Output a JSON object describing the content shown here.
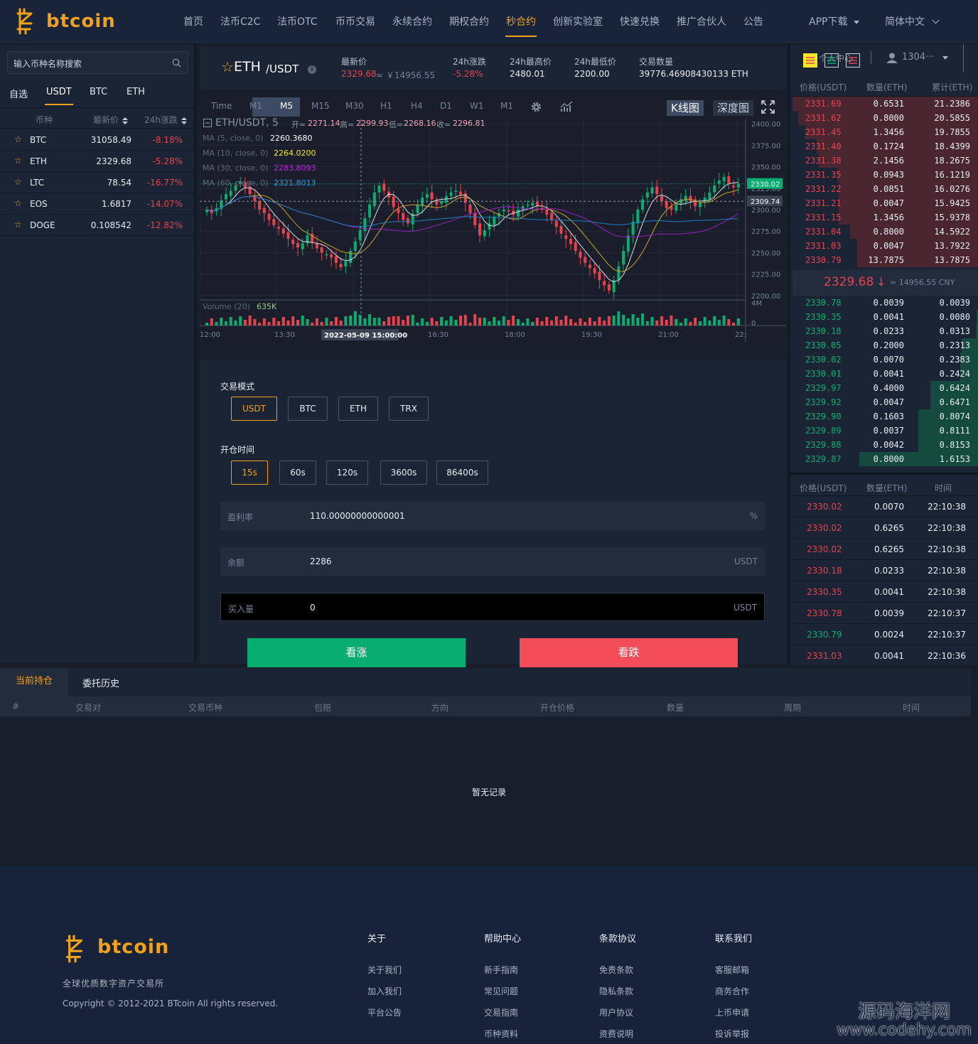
{
  "brand": {
    "name": "btcoin",
    "color": "#f0a21c",
    "tagline": "全球优质数字资产交易所",
    "copyright": "Copyright © 2012-2021 BTcoin All rights reserved."
  },
  "nav": {
    "items": [
      "首页",
      "法币C2C",
      "法币OTC",
      "币币交易",
      "永续合约",
      "期权合约",
      "秒合约",
      "创新实验室",
      "快速兑换",
      "推广合伙人",
      "公告"
    ],
    "active": "秒合约",
    "app_download": "APP下载",
    "language": "简体中文"
  },
  "market": {
    "search_placeholder": "输入币种名称搜索",
    "tabs": [
      "自选",
      "USDT",
      "BTC",
      "ETH"
    ],
    "active_tab": "USDT",
    "headers": {
      "coin": "币种",
      "price": "最新价",
      "change": "24h涨跌"
    },
    "rows": [
      {
        "symbol": "BTC",
        "price": "31058.49",
        "change": "-8.18%"
      },
      {
        "symbol": "ETH",
        "price": "2329.68",
        "change": "-5.28%"
      },
      {
        "symbol": "LTC",
        "price": "78.54",
        "change": "-16.77%"
      },
      {
        "symbol": "EOS",
        "price": "1.6817",
        "change": "-14.07%"
      },
      {
        "symbol": "DOGE",
        "price": "0.108542",
        "change": "-12.82%"
      }
    ]
  },
  "ticker": {
    "star": "☆",
    "base": "ETH",
    "quote": "/USDT",
    "last_label": "最新价",
    "last_price": "2329.68",
    "last_cny": "≈ ￥14956.55",
    "change_label": "24h涨跌",
    "change": "-5.28%",
    "high_label": "24h最高价",
    "high": "2480.01",
    "low_label": "24h最低价",
    "low": "2200.00",
    "volume_label": "交易数量",
    "volume": "39776.46908430133 ETH"
  },
  "chart": {
    "timeframes": [
      "Time",
      "M1",
      "M5",
      "M15",
      "M30",
      "H1",
      "H4",
      "D1",
      "W1",
      "M1"
    ],
    "active_timeframe": "M5",
    "view_kline": "K线图",
    "view_depth": "深度图",
    "legend_pair": "ETH/USDT, 5",
    "ohlc_labels": {
      "open": "开=",
      "high": "高=",
      "low": "低=",
      "close": "收="
    },
    "ohlc": {
      "open": "2271.14",
      "high": "2299.93",
      "low": "2268.16",
      "close": "2296.81"
    },
    "ma": [
      {
        "label": "MA (5, close, 0)",
        "value": "2260.3680",
        "color": "#ffffff"
      },
      {
        "label": "MA (10, close, 0)",
        "value": "2264.0200",
        "color": "#f3e52b"
      },
      {
        "label": "MA (30, close, 0)",
        "value": "2283.8093",
        "color": "#c41ee0"
      },
      {
        "label": "MA (60, close, 0)",
        "value": "2321.8013",
        "color": "#1e9be0"
      }
    ],
    "volume_label": "Volume (20)",
    "volume_value": "635K",
    "price_ticks": [
      "2400.00",
      "2375.00",
      "2350.00",
      "2325.00",
      "2300.00",
      "2275.00",
      "2250.00",
      "2225.00",
      "2200.00"
    ],
    "vol_ticks": [
      "4M",
      "0"
    ],
    "time_ticks": [
      "12:00",
      "13:30",
      "16:30",
      "18:00",
      "19:30",
      "21:00",
      "22:"
    ],
    "crosshair_time": "2022-05-09 15:00:00",
    "last_price_tag": "2330.02",
    "cross_price_tag": "2309.74"
  },
  "chart_data": {
    "type": "candlestick",
    "ylim": [
      2195,
      2405
    ],
    "close_series": [
      2300,
      2296,
      2302,
      2311,
      2318,
      2322,
      2328,
      2333,
      2326,
      2318,
      2310,
      2300,
      2296,
      2288,
      2282,
      2278,
      2272,
      2266,
      2260,
      2256,
      2261,
      2270,
      2262,
      2255,
      2250,
      2248,
      2244,
      2238,
      2233,
      2240,
      2252,
      2263,
      2276,
      2290,
      2306,
      2320,
      2328,
      2322,
      2314,
      2303,
      2296,
      2288,
      2284,
      2295,
      2306,
      2314,
      2318,
      2312,
      2306,
      2310,
      2316,
      2320,
      2322,
      2318,
      2308,
      2296,
      2282,
      2270,
      2276,
      2284,
      2292,
      2296,
      2300,
      2298,
      2294,
      2300,
      2304,
      2306,
      2308,
      2304,
      2300,
      2294,
      2288,
      2280,
      2272,
      2266,
      2260,
      2252,
      2244,
      2238,
      2232,
      2226,
      2218,
      2212,
      2206,
      2218,
      2234,
      2252,
      2270,
      2286,
      2300,
      2312,
      2320,
      2326,
      2318,
      2310,
      2302,
      2300,
      2306,
      2312,
      2316,
      2310,
      2304,
      2308,
      2314,
      2320,
      2328,
      2334,
      2338,
      2330,
      2326,
      2330
    ]
  },
  "form": {
    "mode_label": "交易模式",
    "modes": [
      "USDT",
      "BTC",
      "ETH",
      "TRX"
    ],
    "mode_selected": "USDT",
    "time_label": "开仓时间",
    "times": [
      "15s",
      "60s",
      "120s",
      "3600s",
      "86400s"
    ],
    "time_selected": "15s",
    "profit_label": "盈利率",
    "profit_value": "110.00000000000001",
    "profit_unit": "%",
    "balance_label": "余额",
    "balance_value": "2286",
    "balance_unit": "USDT",
    "amount_label": "买入量",
    "amount_value": "0",
    "amount_unit": "USDT",
    "buy_label": "看涨",
    "sell_label": "看跌"
  },
  "orderbook": {
    "user_label": "个人中心",
    "user_id": "1304···",
    "headers": {
      "price": "价格(USDT)",
      "amount": "数量(ETH)",
      "total": "累计(ETH)"
    },
    "asks": [
      {
        "p": "2331.69",
        "q": "0.6531",
        "c": "21.2386",
        "depth": 1.0
      },
      {
        "p": "2331.62",
        "q": "0.8000",
        "c": "20.5855",
        "depth": 0.97
      },
      {
        "p": "2331.45",
        "q": "1.3456",
        "c": "19.7855",
        "depth": 0.93
      },
      {
        "p": "2331.40",
        "q": "0.1724",
        "c": "18.4399",
        "depth": 0.87
      },
      {
        "p": "2331.38",
        "q": "2.1456",
        "c": "18.2675",
        "depth": 0.86
      },
      {
        "p": "2331.35",
        "q": "0.0943",
        "c": "16.1219",
        "depth": 0.76
      },
      {
        "p": "2331.22",
        "q": "0.0851",
        "c": "16.0276",
        "depth": 0.75
      },
      {
        "p": "2331.21",
        "q": "0.0047",
        "c": "15.9425",
        "depth": 0.75
      },
      {
        "p": "2331.15",
        "q": "1.3456",
        "c": "15.9378",
        "depth": 0.75
      },
      {
        "p": "2331.04",
        "q": "0.8000",
        "c": "14.5922",
        "depth": 0.69
      },
      {
        "p": "2331.03",
        "q": "0.0047",
        "c": "13.7922",
        "depth": 0.65
      },
      {
        "p": "2330.79",
        "q": "13.7875",
        "c": "13.7875",
        "depth": 0.65
      }
    ],
    "mid_price": "2329.68",
    "mid_arrow": "↓",
    "mid_cny": "≈ 14956.55 CNY",
    "bids": [
      {
        "p": "2330.78",
        "q": "0.0039",
        "c": "0.0039",
        "depth": 0.0
      },
      {
        "p": "2330.35",
        "q": "0.0041",
        "c": "0.0080",
        "depth": 0.01
      },
      {
        "p": "2330.18",
        "q": "0.0233",
        "c": "0.0313",
        "depth": 0.02
      },
      {
        "p": "2330.05",
        "q": "0.2000",
        "c": "0.2313",
        "depth": 0.14
      },
      {
        "p": "2330.02",
        "q": "0.0070",
        "c": "0.2383",
        "depth": 0.15
      },
      {
        "p": "2330.01",
        "q": "0.0041",
        "c": "0.2424",
        "depth": 0.15
      },
      {
        "p": "2329.97",
        "q": "0.4000",
        "c": "0.6424",
        "depth": 0.4
      },
      {
        "p": "2329.92",
        "q": "0.0047",
        "c": "0.6471",
        "depth": 0.4
      },
      {
        "p": "2329.90",
        "q": "0.1603",
        "c": "0.8074",
        "depth": 0.5
      },
      {
        "p": "2329.89",
        "q": "0.0037",
        "c": "0.8111",
        "depth": 0.5
      },
      {
        "p": "2329.88",
        "q": "0.0042",
        "c": "0.8153",
        "depth": 0.5
      },
      {
        "p": "2329.87",
        "q": "0.8000",
        "c": "1.6153",
        "depth": 1.0
      }
    ],
    "trades_headers": {
      "price": "价格(USDT)",
      "amount": "数量(ETH)",
      "time": "时间"
    },
    "trades": [
      {
        "p": "2330.02",
        "q": "0.0070",
        "t": "22:10:38",
        "side": "sell"
      },
      {
        "p": "2330.02",
        "q": "0.6265",
        "t": "22:10:38",
        "side": "sell"
      },
      {
        "p": "2330.02",
        "q": "0.6265",
        "t": "22:10:38",
        "side": "sell"
      },
      {
        "p": "2330.18",
        "q": "0.0233",
        "t": "22:10:38",
        "side": "sell"
      },
      {
        "p": "2330.35",
        "q": "0.0041",
        "t": "22:10:38",
        "side": "sell"
      },
      {
        "p": "2330.78",
        "q": "0.0039",
        "t": "22:10:37",
        "side": "sell"
      },
      {
        "p": "2330.79",
        "q": "0.0024",
        "t": "22:10:37",
        "side": "buy"
      },
      {
        "p": "2331.03",
        "q": "0.0041",
        "t": "22:10:36",
        "side": "sell"
      }
    ]
  },
  "positions": {
    "tabs": [
      "当前持仓",
      "委托历史"
    ],
    "headers": [
      "#",
      "交易对",
      "交易币种",
      "包赔",
      "方向",
      "开仓价格",
      "数量",
      "周期",
      "时间"
    ],
    "empty": "暂无记录"
  },
  "footer": {
    "cols": [
      {
        "title": "关于",
        "links": [
          "关于我们",
          "加入我们",
          "平台公告"
        ]
      },
      {
        "title": "帮助中心",
        "links": [
          "新手指南",
          "常见问题",
          "交易指南",
          "币种资料"
        ]
      },
      {
        "title": "条款协议",
        "links": [
          "免责条款",
          "隐私条款",
          "用户协议",
          "资费说明"
        ]
      },
      {
        "title": "联系我们",
        "links": [
          "客服邮箱",
          "商务合作",
          "上币申请",
          "投诉举报"
        ]
      }
    ]
  },
  "watermark": {
    "line1": "源码海洋网",
    "line2": "www.codehy.com"
  },
  "colors": {
    "up": "#08ad72",
    "down": "#e8424f",
    "accent": "#f0a21c",
    "bg": "#181f2b",
    "panel": "#1b2434"
  }
}
